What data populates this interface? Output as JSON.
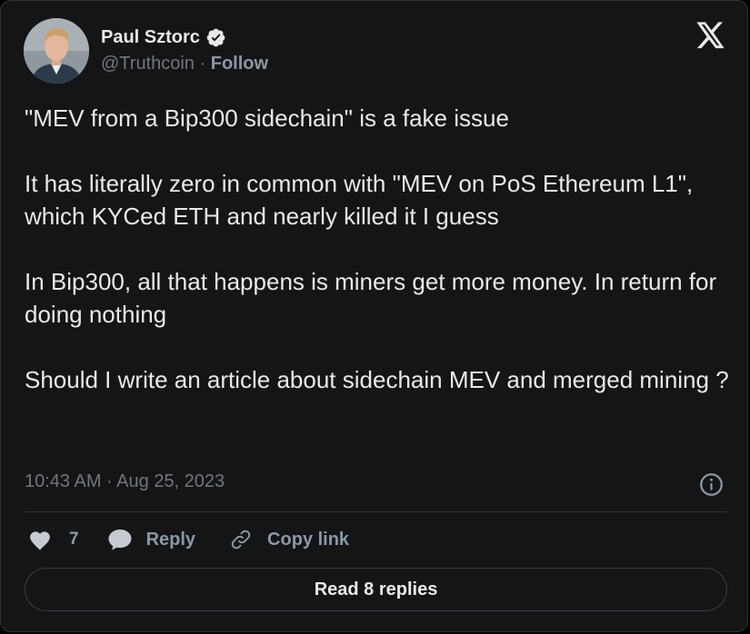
{
  "author": {
    "name": "Paul Sztorc",
    "handle": "@Truthcoin",
    "separator": "·",
    "follow_label": "Follow",
    "verified": true
  },
  "tweet": {
    "paragraphs": [
      "\"MEV from a Bip300 sidechain\" is a fake issue",
      "It has literally zero in common with \"MEV on PoS Ethereum L1\", which KYCed ETH and nearly killed it I guess",
      "In Bip300, all that happens is miners get more money. In return for doing nothing",
      "Should I write an article about sidechain MEV and merged mining ?"
    ],
    "timestamp": "10:43 AM · Aug 25, 2023"
  },
  "actions": {
    "like_count": "7",
    "reply_label": "Reply",
    "copy_link_label": "Copy link"
  },
  "read_replies_label": "Read 8 replies",
  "icons": {
    "verified": "verified-badge-icon",
    "platform": "x-logo-icon",
    "info": "info-icon",
    "like": "heart-icon",
    "reply": "speech-bubble-icon",
    "copy": "link-icon"
  },
  "colors": {
    "card_background": "#141517",
    "primary_text": "#e7e9ea",
    "secondary_text": "#71767b",
    "border": "#2f3336"
  }
}
